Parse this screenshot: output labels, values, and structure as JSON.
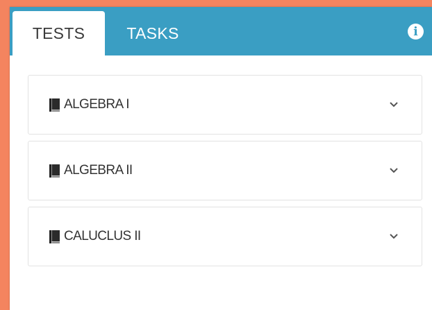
{
  "tabs": [
    {
      "label": "TESTS",
      "active": true
    },
    {
      "label": "TASKS",
      "active": false
    }
  ],
  "header": {
    "info_icon": "info-icon"
  },
  "subjects": [
    {
      "label": "ALGEBRA I",
      "icon": "book-icon"
    },
    {
      "label": "ALGEBRA II",
      "icon": "book-icon"
    },
    {
      "label": "CALUCLUS II",
      "icon": "book-icon"
    }
  ],
  "colors": {
    "background": "#f4845f",
    "header": "#3a9ec3",
    "panel": "#ffffff"
  }
}
